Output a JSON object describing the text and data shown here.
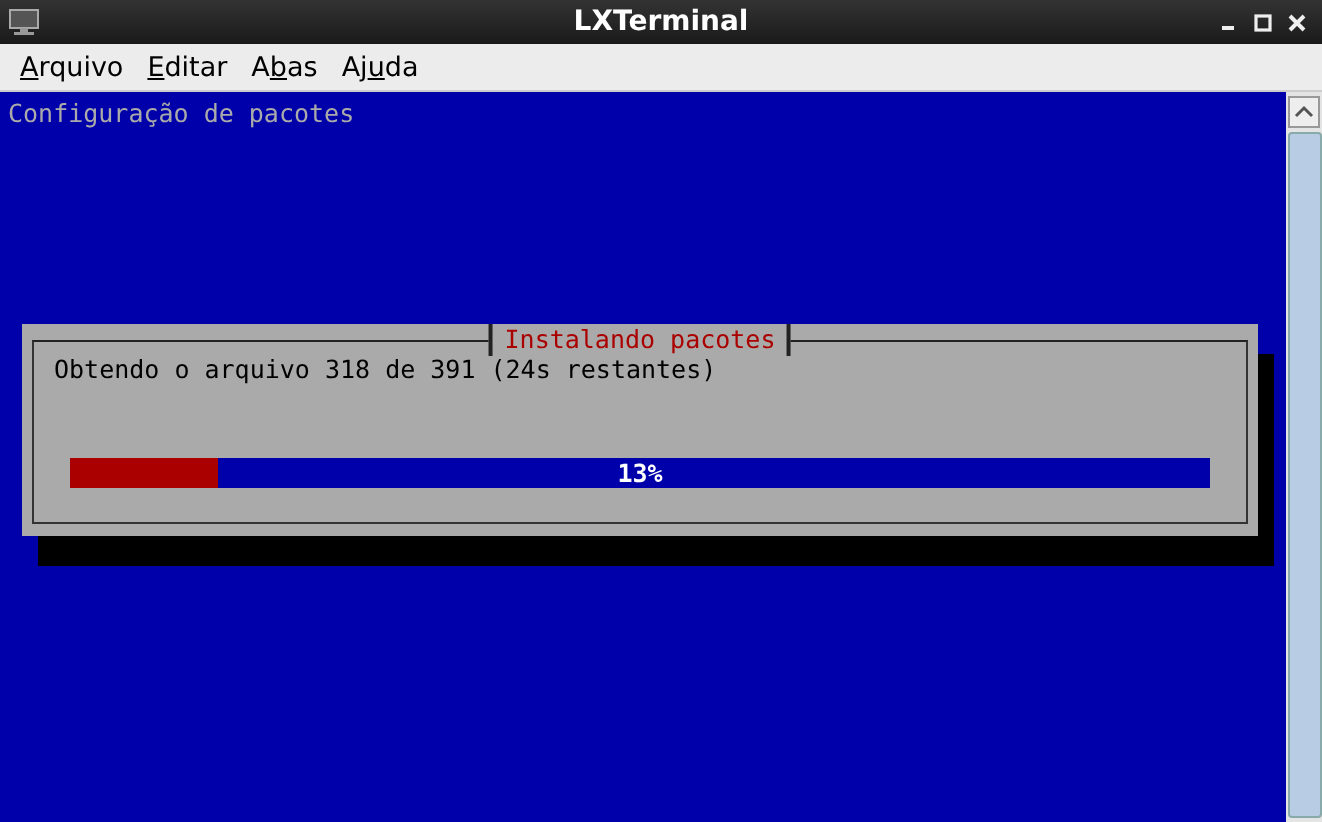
{
  "window": {
    "title": "LXTerminal"
  },
  "menu": [
    {
      "key": "A",
      "after": "rquivo"
    },
    {
      "key": "E",
      "after": "ditar"
    },
    {
      "before": "A",
      "key": "b",
      "after": "as"
    },
    {
      "before": "Aj",
      "key": "u",
      "after": "da"
    }
  ],
  "terminal": {
    "header": "Configuração de pacotes"
  },
  "dialog": {
    "title": "Instalando pacotes",
    "message": "Obtendo o arquivo 318 de 391 (24s restantes)",
    "progress": {
      "level": 0.13,
      "reading": "13%"
    }
  }
}
